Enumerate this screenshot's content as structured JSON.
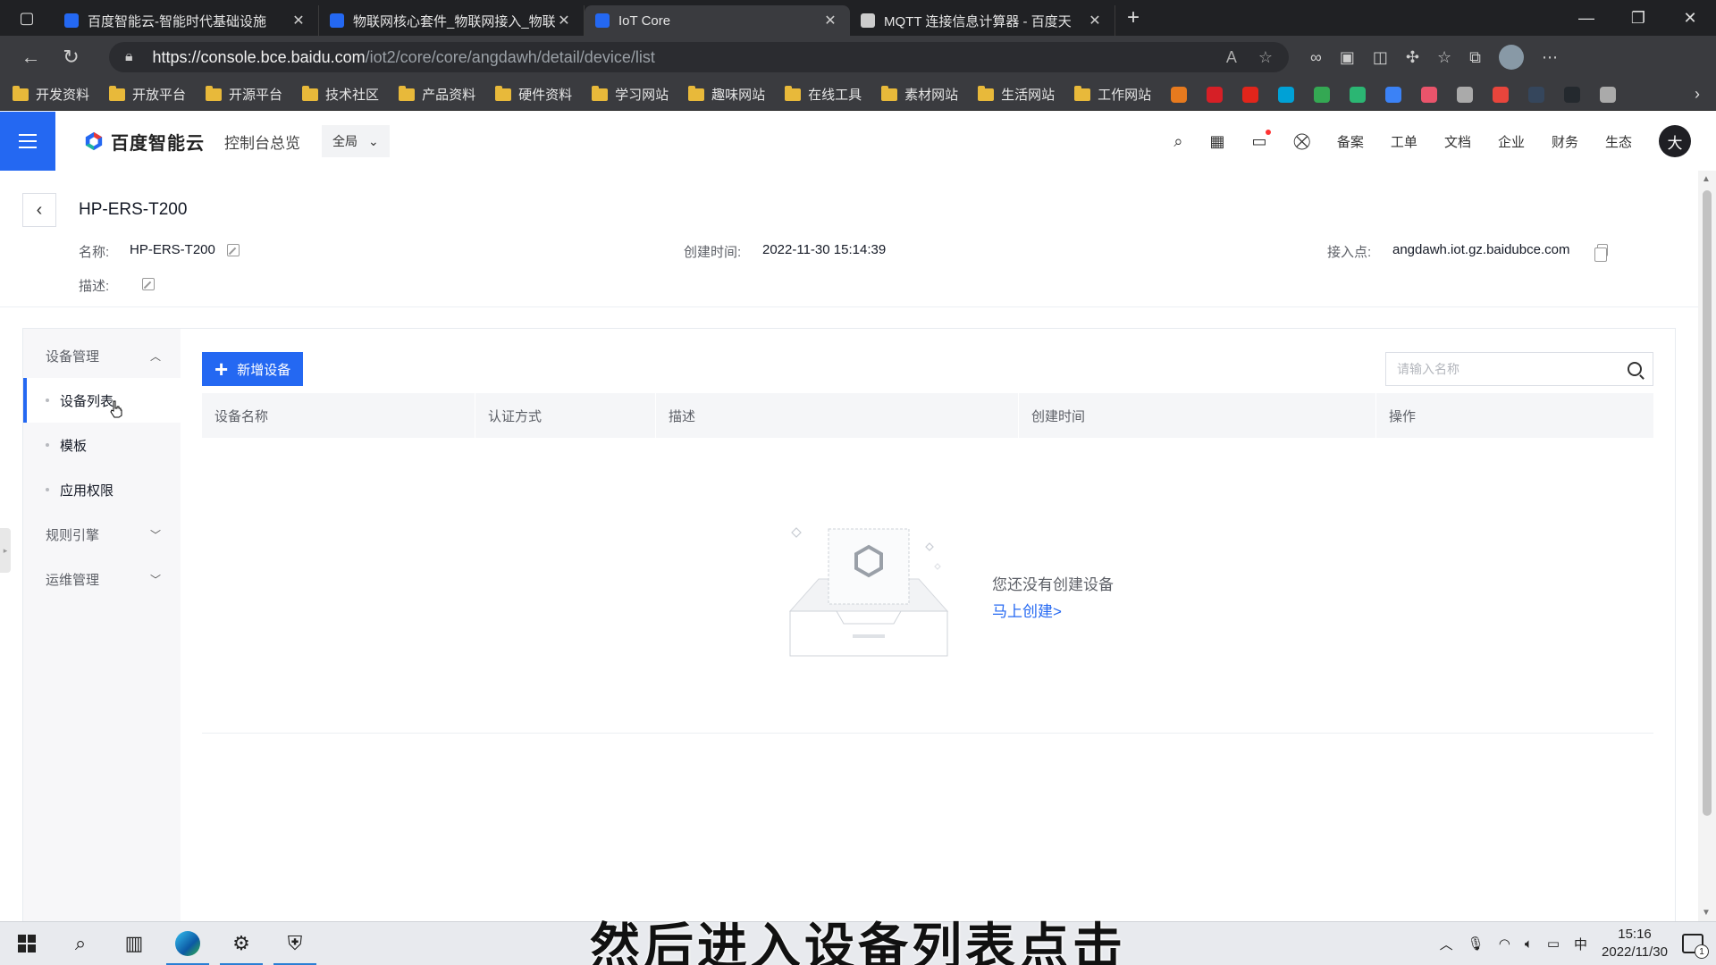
{
  "browser": {
    "tabs": [
      {
        "title": "百度智能云-智能时代基础设施",
        "favicon_color": "#2468f2",
        "active": false
      },
      {
        "title": "物联网核心套件_物联网接入_物联",
        "favicon_color": "#2468f2",
        "active": false
      },
      {
        "title": "IoT Core",
        "favicon_color": "#2468f2",
        "active": true
      },
      {
        "title": "MQTT 连接信息计算器 - 百度天",
        "favicon_color": "#cccccc",
        "active": false
      }
    ],
    "url_host": "https://console.bce.baidu.com",
    "url_path": "/iot2/core/core/angdawh/detail/device/list",
    "bookmarks": [
      "开发资料",
      "开放平台",
      "开源平台",
      "技术社区",
      "产品资料",
      "硬件资料",
      "学习网站",
      "趣味网站",
      "在线工具",
      "素材网站",
      "生活网站",
      "工作网站"
    ]
  },
  "console": {
    "brand": "百度智能云",
    "overview": "控制台总览",
    "region": "全局",
    "nav": [
      "备案",
      "工单",
      "文档",
      "企业",
      "财务",
      "生态"
    ],
    "user_initial": "大"
  },
  "device": {
    "title": "HP-ERS-T200",
    "name_label": "名称:",
    "name_value": "HP-ERS-T200",
    "created_label": "创建时间:",
    "created_value": "2022-11-30 15:14:39",
    "endpoint_label": "接入点:",
    "endpoint_value": "angdawh.iot.gz.baidubce.com",
    "desc_label": "描述:"
  },
  "sidemenu": {
    "group_device": "设备管理",
    "items": [
      "设备列表",
      "模板",
      "应用权限"
    ],
    "group_rules": "规则引擎",
    "group_ops": "运维管理"
  },
  "main": {
    "add_button": "新增设备",
    "search_placeholder": "请输入名称",
    "columns": [
      "设备名称",
      "认证方式",
      "描述",
      "创建时间",
      "操作"
    ],
    "empty_text": "您还没有创建设备",
    "empty_link": "马上创建>"
  },
  "subtitle": "然后进入设备列表点击",
  "taskbar": {
    "time": "15:16",
    "date": "2022/11/30",
    "ime": "中",
    "notifications": "1"
  },
  "colors": {
    "accent": "#2468f2",
    "chrome_dark": "#202124"
  }
}
